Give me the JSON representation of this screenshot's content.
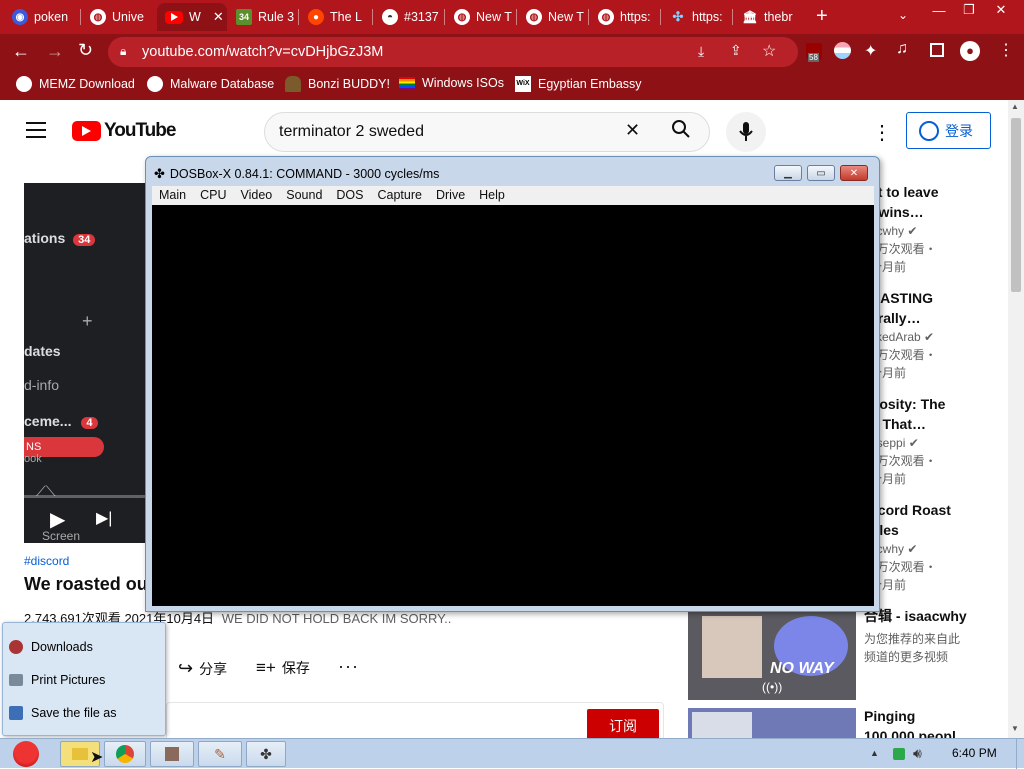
{
  "browser": {
    "tabs": [
      {
        "label": "poken",
        "icon": "pokemon-icon"
      },
      {
        "label": "Unive",
        "icon": "globe-icon"
      },
      {
        "label": "W",
        "icon": "youtube-icon",
        "active": true
      },
      {
        "label": "Rule 3",
        "icon": "rule34-icon"
      },
      {
        "label": "The L",
        "icon": "reddit-icon"
      },
      {
        "label": "#3137",
        "icon": "github-icon"
      },
      {
        "label": "New T",
        "icon": "globe-icon"
      },
      {
        "label": "New T",
        "icon": "globe-icon"
      },
      {
        "label": "https:",
        "icon": "globe-icon"
      },
      {
        "label": "https:",
        "icon": "puzzle-site-icon"
      },
      {
        "label": "thebr",
        "icon": "museum-icon"
      }
    ],
    "url": "youtube.com/watch?v=cvDHjbGzJ3M",
    "extension_badge": "58",
    "bookmarks": [
      {
        "label": "MEMZ Download",
        "icon": "globe-icon"
      },
      {
        "label": "Malware Database",
        "icon": "globe-icon"
      },
      {
        "label": "Bonzi BUDDY!",
        "icon": "bonzi-icon"
      },
      {
        "label": "Windows ISOs",
        "icon": "rainbow-flag-icon"
      },
      {
        "label": "Egyptian Embassy",
        "icon": "wix-icon"
      }
    ],
    "accent_color": "#b0161c"
  },
  "youtube": {
    "logo": "YouTube",
    "search_query": "terminator 2 sweded",
    "signin_label": "登录",
    "video": {
      "overlay": {
        "item1": "ations",
        "item1_badge": "34",
        "item2": "dates",
        "item3": "d-info",
        "item4": "ceme...",
        "item4_badge": "4",
        "item5": "NS",
        "item6": "ook",
        "screen_label": "Screen"
      },
      "hashtag": "#discord",
      "title": "We roasted ou",
      "views_date": "2,743,691次观看  2021年10月4日",
      "desc_preview": "WE DID NOT HOLD BACK IM SORRY..",
      "share_label": "分享",
      "save_label": "保存",
      "subscribe_label": "订阅"
    },
    "recommendations": [
      {
        "title1": "st to leave",
        "title2": ": wins…",
        "channel": "acwhy",
        "views": "0万次观看・",
        "age": "个月前"
      },
      {
        "title1": "DASTING",
        "title2": "erally…",
        "channel": "skedArab",
        "views": "0万次观看・",
        "age": "个月前"
      },
      {
        "title1": "riosity: The",
        "title2": "p That…",
        "channel": "eseppi",
        "views": "1万次观看・",
        "age": "个月前"
      },
      {
        "title1": "scord Roast",
        "title2": "ttles",
        "channel": "acwhy",
        "views": "9万次观看・",
        "age": "个月前"
      }
    ],
    "mix": {
      "title": "合辑 - isaacwhy",
      "sub1": "为您推荐的来自此",
      "sub2": "频道的更多视频",
      "thumb_text": "NO WAY"
    },
    "next": {
      "title": "Pinging",
      "sub": "100,000 peopl"
    }
  },
  "dosbox": {
    "title": "DOSBox-X 0.84.1: COMMAND - 3000 cycles/ms",
    "menu": [
      "Main",
      "CPU",
      "Video",
      "Sound",
      "DOS",
      "Capture",
      "Drive",
      "Help"
    ]
  },
  "start_menu": {
    "items": [
      {
        "label": "Downloads",
        "icon": "downloads-icon"
      },
      {
        "label": "Print Pictures",
        "icon": "printer-icon"
      },
      {
        "label": "Save the file as",
        "icon": "save-icon"
      }
    ]
  },
  "taskbar": {
    "clock": "6:40 PM"
  }
}
